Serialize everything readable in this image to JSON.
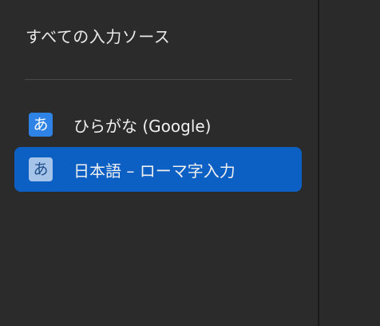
{
  "header": {
    "title": "すべての入力ソース"
  },
  "sources": [
    {
      "icon_char": "あ",
      "icon": "hiragana-a-icon",
      "label": "ひらがな (Google)",
      "selected": false
    },
    {
      "icon_char": "あ",
      "icon": "hiragana-a-icon",
      "label": "日本語 – ローマ字入力",
      "selected": true
    }
  ],
  "colors": {
    "background": "#2c2b2c",
    "selection": "#0c60c4",
    "badge_blue": "#2f83e6",
    "badge_light": "#a6c4ea",
    "text": "#f0f0f0"
  }
}
